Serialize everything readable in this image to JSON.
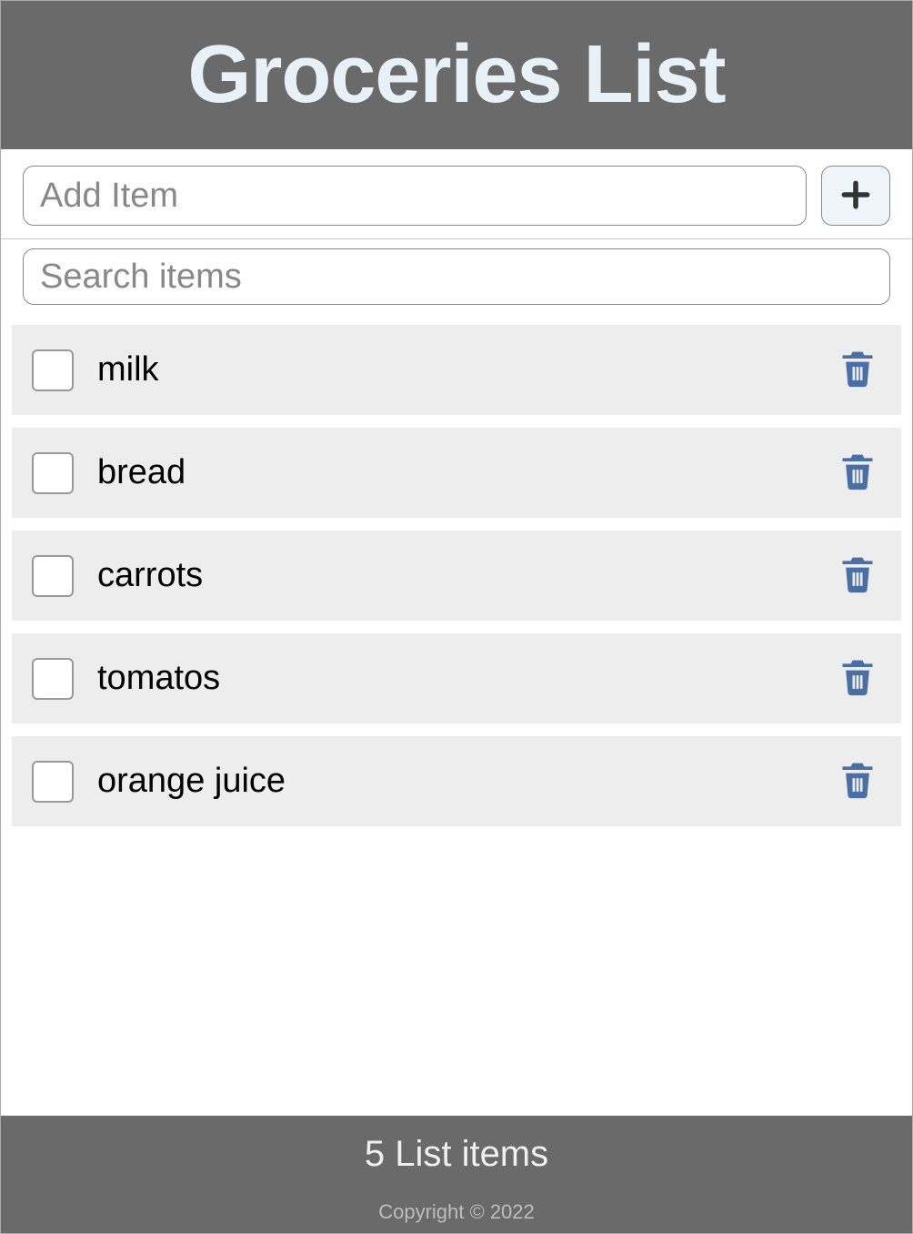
{
  "header": {
    "title": "Groceries List"
  },
  "controls": {
    "add_placeholder": "Add Item",
    "search_placeholder": "Search items"
  },
  "items": [
    {
      "label": "milk",
      "checked": false
    },
    {
      "label": "bread",
      "checked": false
    },
    {
      "label": "carrots",
      "checked": false
    },
    {
      "label": "tomatos",
      "checked": false
    },
    {
      "label": "orange juice",
      "checked": false
    }
  ],
  "footer": {
    "count_text": "5 List items",
    "copyright": "Copyright © 2022"
  }
}
